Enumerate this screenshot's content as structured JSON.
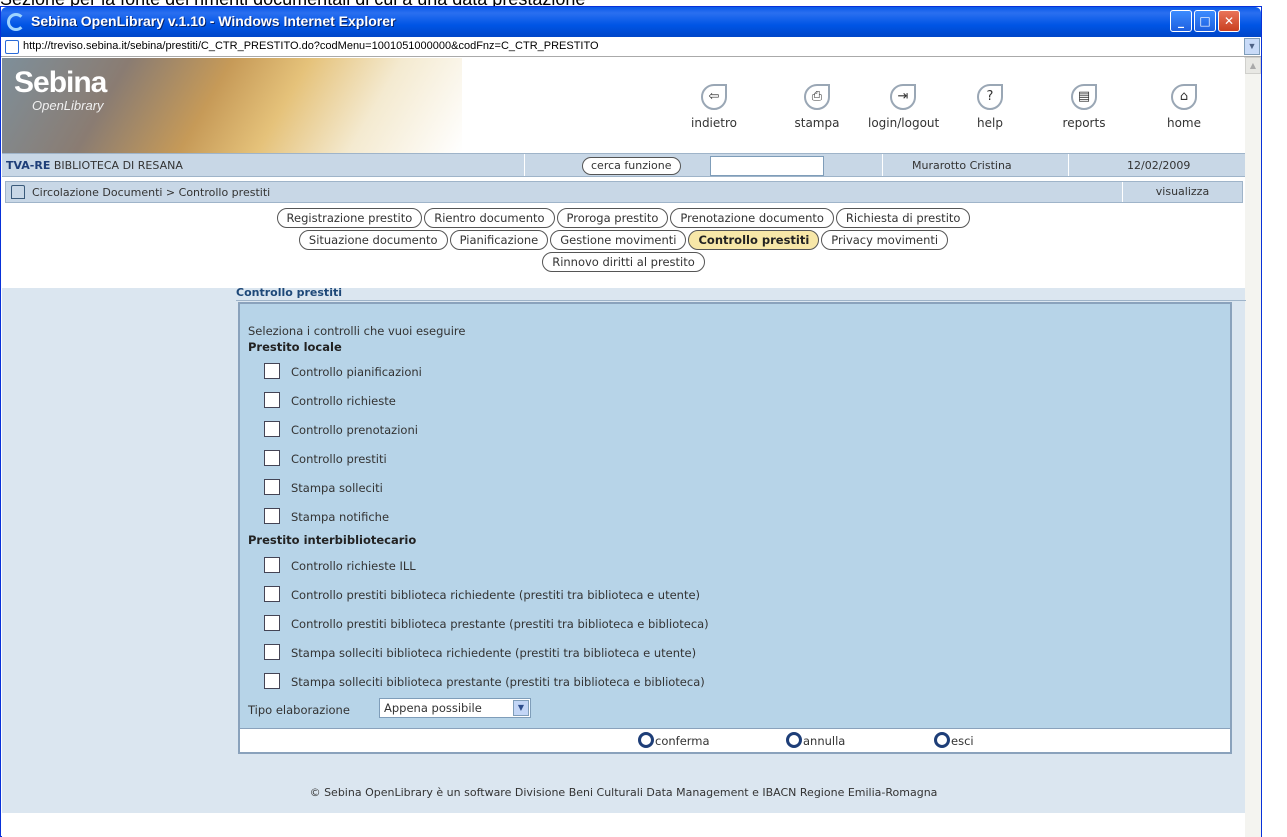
{
  "top_cut_text": "Sezione per la fonte dei rimenti documentali di cui a una data prestazione",
  "window": {
    "title": "Sebina OpenLibrary v.1.10 - Windows Internet Explorer",
    "url": "http://treviso.sebina.it/sebina/prestiti/C_CTR_PRESTITO.do?codMenu=1001051000000&codFnz=C_CTR_PRESTITO"
  },
  "logo": {
    "main": "Sebina",
    "sub": "OpenLibrary"
  },
  "toolbar": {
    "items": [
      {
        "label": "indietro",
        "icon": "back-icon",
        "glyph": "⇦"
      },
      {
        "label": "stampa",
        "icon": "print-icon",
        "glyph": "⎙"
      },
      {
        "label": "login/logout",
        "icon": "logout-icon",
        "glyph": "⇥"
      },
      {
        "label": "help",
        "icon": "help-icon",
        "glyph": "?"
      },
      {
        "label": "reports",
        "icon": "reports-icon",
        "glyph": "▤"
      },
      {
        "label": "home",
        "icon": "home-icon",
        "glyph": "⌂"
      }
    ]
  },
  "infobar": {
    "lib_code": "TVA-RE",
    "lib_name": " BIBLIOTECA DI RESANA",
    "cerca_label": "cerca funzione",
    "search_value": "",
    "user": "Murarotto Cristina",
    "date": "12/02/2009"
  },
  "navbar": {
    "breadcrumb": "Circolazione Documenti > Controllo prestiti",
    "visualizza": "visualizza"
  },
  "tabs": {
    "row1": [
      "Registrazione prestito",
      "Rientro documento",
      "Proroga prestito",
      "Prenotazione documento",
      "Richiesta di prestito"
    ],
    "row2": [
      "Situazione documento",
      "Pianificazione",
      "Gestione movimenti",
      "Controllo prestiti",
      "Privacy movimenti"
    ],
    "row3": [
      "Rinnovo diritti al prestito"
    ],
    "active": "Controllo prestiti"
  },
  "panel": {
    "title": "Controllo prestiti",
    "hint": "Seleziona i controlli che vuoi eseguire",
    "group_locale": "Prestito locale",
    "locale_options": [
      {
        "label": "Controllo pianificazioni",
        "checked": false
      },
      {
        "label": "Controllo richieste",
        "checked": false
      },
      {
        "label": "Controllo prenotazioni",
        "checked": false
      },
      {
        "label": "Controllo prestiti",
        "checked": false
      },
      {
        "label": "Stampa solleciti",
        "checked": false
      },
      {
        "label": "Stampa notifiche",
        "checked": false
      }
    ],
    "group_ill": "Prestito interbibliotecario",
    "ill_options": [
      {
        "label": "Controllo richieste ILL",
        "checked": false
      },
      {
        "label": "Controllo prestiti biblioteca richiedente (prestiti tra biblioteca e utente)",
        "checked": false
      },
      {
        "label": "Controllo prestiti biblioteca prestante (prestiti tra biblioteca e biblioteca)",
        "checked": false
      },
      {
        "label": "Stampa solleciti biblioteca richiedente (prestiti tra biblioteca e utente)",
        "checked": false
      },
      {
        "label": "Stampa solleciti biblioteca prestante (prestiti tra biblioteca e biblioteca)",
        "checked": false
      }
    ],
    "tipo_label": "Tipo elaborazione",
    "tipo_value": "Appena possibile",
    "actions": {
      "conferma": "conferma",
      "annulla": "annulla",
      "esci": "esci"
    }
  },
  "footer": {
    "copyright": "© Sebina OpenLibrary è un software   Divisione Beni Culturali Data Management  e  IBACN Regione Emilia-Romagna"
  },
  "colors": {
    "titlebar": "#0055e5",
    "panel_bg": "#b7d4e8",
    "band_bg": "#dbe6f0",
    "active_tab": "#f7e7a8",
    "header_link": "#1e4878"
  }
}
